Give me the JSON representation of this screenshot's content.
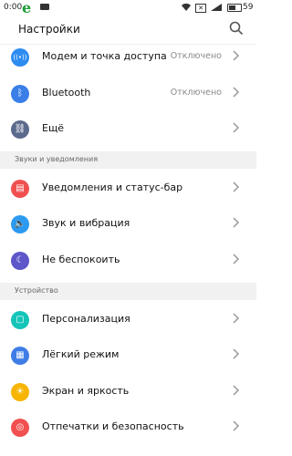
{
  "status_bar": {
    "time": "0:00",
    "battery_level": "59",
    "battery_fraction": 0.59
  },
  "header": {
    "title": "Настройки",
    "search_icon": "search-icon"
  },
  "rows_top": [
    {
      "label": "Модем и точка доступа",
      "value": "Отключено",
      "icon": "hotspot-icon",
      "color": "#2d8cf0"
    },
    {
      "label": "Bluetooth",
      "value": "Отключено",
      "icon": "bluetooth-icon",
      "color": "#3a7fe8"
    },
    {
      "label": "Ещё",
      "value": "",
      "icon": "link-icon",
      "color": "#5b6a8c"
    }
  ],
  "section_sounds": "Звуки и уведомления",
  "rows_sounds": [
    {
      "label": "Уведомления и статус-бар",
      "value": "",
      "icon": "notifications-icon",
      "color": "#f0504f"
    },
    {
      "label": "Звук и вибрация",
      "value": "",
      "icon": "sound-icon",
      "color": "#2b9af0"
    },
    {
      "label": "Не беспокоить",
      "value": "",
      "icon": "moon-icon",
      "color": "#5d57c9"
    }
  ],
  "section_device": "Устройство",
  "rows_device": [
    {
      "label": "Персонализация",
      "value": "",
      "icon": "personalization-icon",
      "color": "#14c4b8"
    },
    {
      "label": "Лёгкий режим",
      "value": "",
      "icon": "easy-mode-icon",
      "color": "#3f7ce6"
    },
    {
      "label": "Экран и яркость",
      "value": "",
      "icon": "brightness-icon",
      "color": "#f7b500"
    },
    {
      "label": "Отпечатки и безопасность",
      "value": "",
      "icon": "fingerprint-icon",
      "color": "#f0504f"
    }
  ]
}
